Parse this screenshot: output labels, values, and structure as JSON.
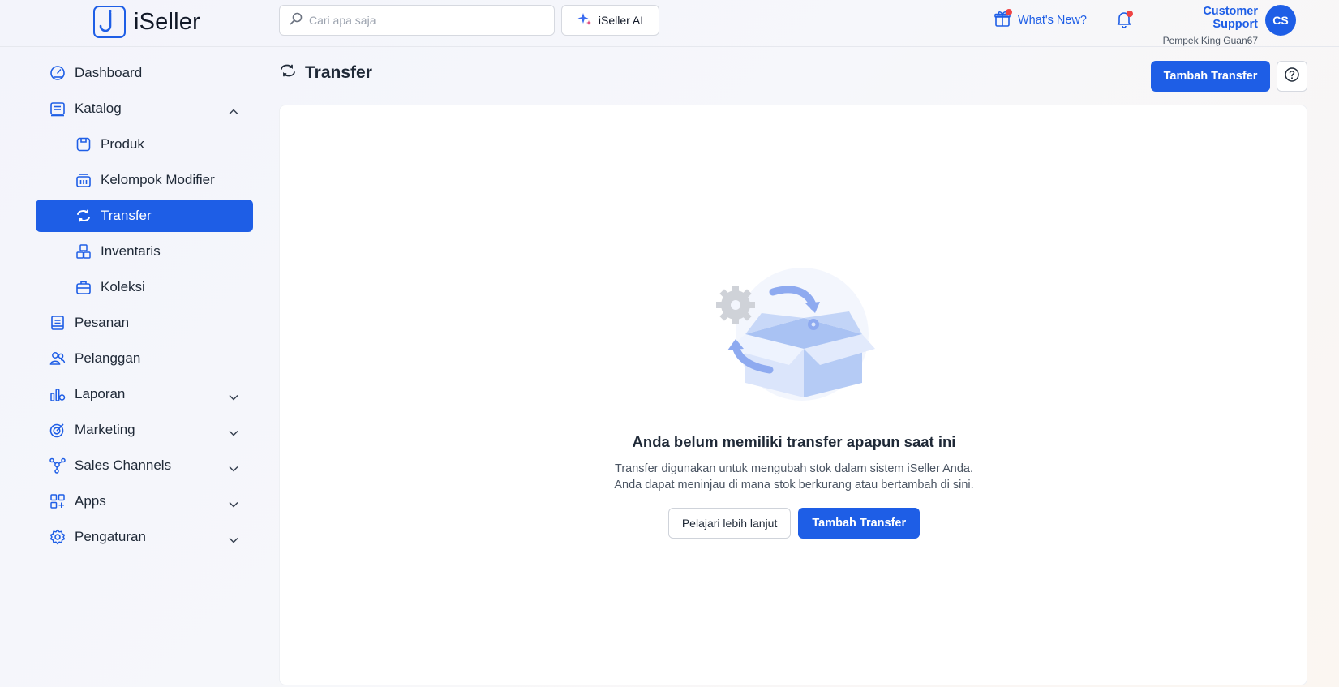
{
  "header": {
    "logo_text": "iSeller",
    "search_placeholder": "Cari apa saja",
    "ai_label": "iSeller AI",
    "whats_new": "What's New?",
    "user_name": "Customer Support",
    "store_name": "Pempek King Guan67",
    "avatar_initials": "CS"
  },
  "sidebar": {
    "items": [
      {
        "label": "Dashboard",
        "icon": "dashboard-icon"
      },
      {
        "label": "Katalog",
        "icon": "catalog-icon",
        "expanded": true
      },
      {
        "label": "Produk",
        "icon": "product-icon"
      },
      {
        "label": "Kelompok Modifier",
        "icon": "modifier-icon"
      },
      {
        "label": "Transfer",
        "icon": "transfer-icon",
        "active": true
      },
      {
        "label": "Inventaris",
        "icon": "inventory-icon"
      },
      {
        "label": "Koleksi",
        "icon": "collection-icon"
      },
      {
        "label": "Pesanan",
        "icon": "orders-icon"
      },
      {
        "label": "Pelanggan",
        "icon": "customers-icon"
      },
      {
        "label": "Laporan",
        "icon": "reports-icon"
      },
      {
        "label": "Marketing",
        "icon": "marketing-icon"
      },
      {
        "label": "Sales Channels",
        "icon": "sales-channels-icon"
      },
      {
        "label": "Apps",
        "icon": "apps-icon"
      },
      {
        "label": "Pengaturan",
        "icon": "settings-icon"
      }
    ]
  },
  "main": {
    "title": "Transfer",
    "add_button": "Tambah Transfer",
    "empty": {
      "title": "Anda belum memiliki transfer apapun saat ini",
      "desc_line1": "Transfer digunakan untuk mengubah stok dalam sistem iSeller Anda.",
      "desc_line2": "Anda dapat meninjau di mana stok berkurang atau bertambah di sini.",
      "learn_more": "Pelajari lebih lanjut",
      "add_button": "Tambah Transfer"
    }
  },
  "colors": {
    "accent": "#1e5ee6",
    "notification": "#ef4444"
  }
}
